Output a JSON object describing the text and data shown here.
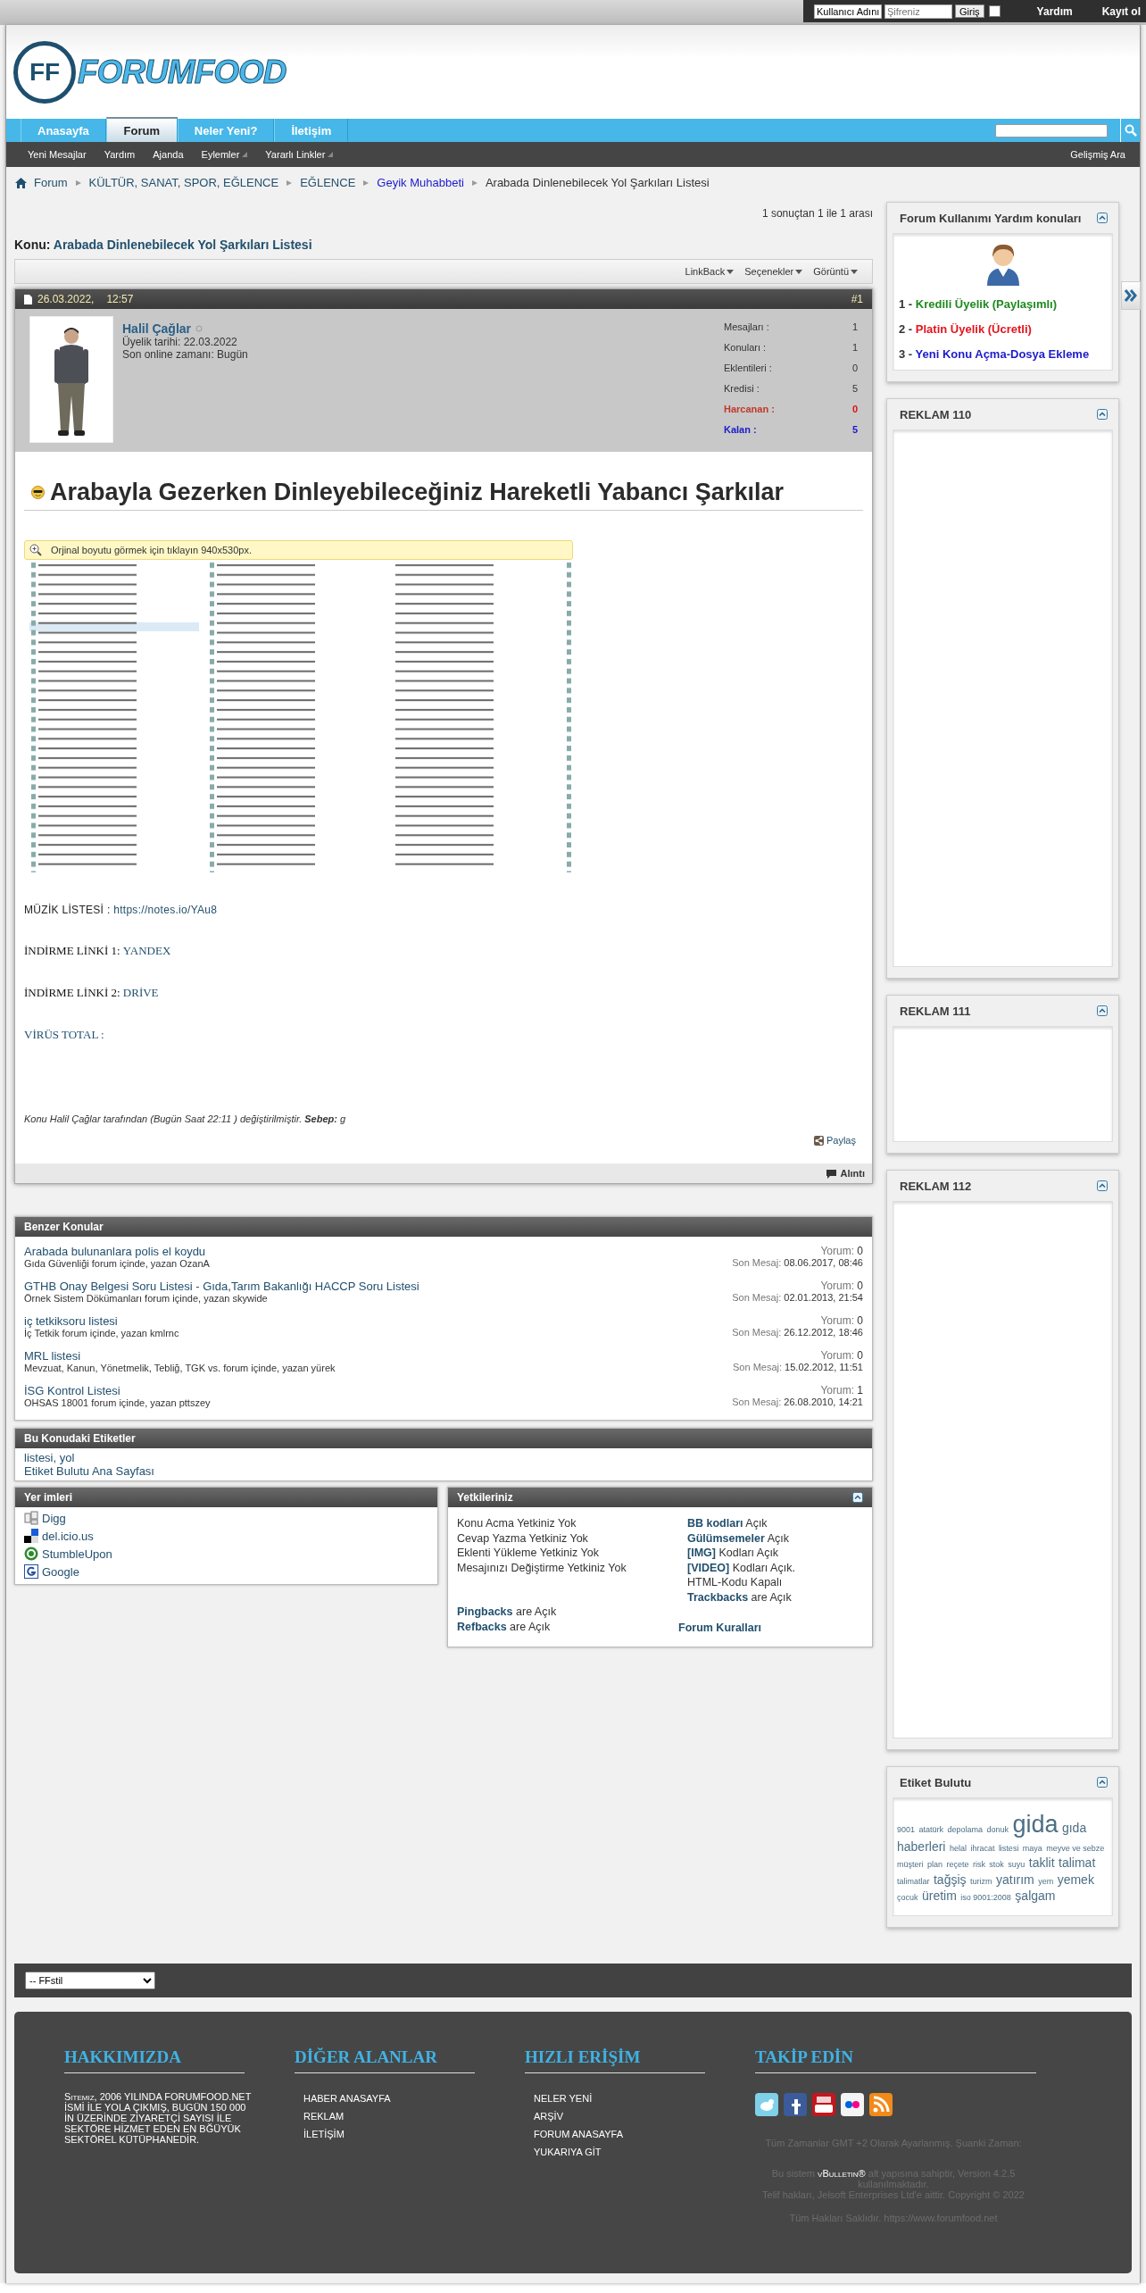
{
  "top_bar": {
    "username_field": {
      "value": "Kullanıcı Adını"
    },
    "password_field": {
      "placeholder": "Şifreniz"
    },
    "login_button": "Giriş",
    "remember_me": {
      "checked": false
    },
    "links": [
      "Yardım",
      "Kayıt ol"
    ]
  },
  "logo": {
    "mark": "FF",
    "name": "FORUMFOOD"
  },
  "nav": {
    "tabs": [
      {
        "label": "Anasayfa",
        "selected": false
      },
      {
        "label": "Forum",
        "selected": true
      },
      {
        "label": "Neler Yeni?",
        "selected": false
      },
      {
        "label": "İletişim",
        "selected": false
      }
    ]
  },
  "sub_nav": {
    "items": [
      {
        "label": "Yeni Mesajlar",
        "has_menu": false
      },
      {
        "label": "Yardım",
        "has_menu": false
      },
      {
        "label": "Ajanda",
        "has_menu": false
      },
      {
        "label": "Eylemler",
        "has_menu": true
      },
      {
        "label": "Yararlı Linkler",
        "has_menu": true
      }
    ],
    "right": "Gelişmiş Ara"
  },
  "breadcrumb": [
    {
      "label": "Forum",
      "kind": "link"
    },
    {
      "label": "KÜLTÜR, SANAT, SPOR, EĞLENCE",
      "kind": "link"
    },
    {
      "label": "EĞLENCE",
      "kind": "link"
    },
    {
      "label": "Geyik Muhabbeti",
      "kind": "forum"
    },
    {
      "label": "Arabada Dinlenebilecek Yol Şarkıları Listesi",
      "kind": "current"
    }
  ],
  "pagination_info": "1 sonuçtan 1 ile 1 arası",
  "thread": {
    "prefix": "Konu:",
    "title": "Arabada Dinlenebilecek Yol Şarkıları Listesi"
  },
  "toolbar": [
    "LinkBack",
    "Seçenekler",
    "Görüntü"
  ],
  "post": {
    "date": "26.03.2022,",
    "time": "12:57",
    "number": "#1",
    "author": {
      "name": "Halil Çağlar",
      "online": false,
      "joined": "Üyelik tarihi: 22.03.2022",
      "last_online": "Son online zamanı: Bugün"
    },
    "stats": [
      {
        "label": "Mesajları :",
        "value": "1",
        "kind": "plain"
      },
      {
        "label": "Konuları :",
        "value": "1",
        "kind": "plain"
      },
      {
        "label": "Eklentileri :",
        "value": "0",
        "kind": "plain"
      },
      {
        "label": "Kredisi :",
        "value": "5",
        "kind": "plain"
      },
      {
        "label": "Harcanan :",
        "value": "0",
        "kind": "spent"
      },
      {
        "label": "Kalan :",
        "value": "5",
        "kind": "remaining"
      }
    ],
    "heading": "Arabayla Gezerken Dinleyebileceğiniz Hareketli Yabancı Şarkılar",
    "image_notice": "Orjinal boyutu görmek için tıklayın 940x530px.",
    "lines": [
      {
        "label": "MÜZİK LİSTESİ : ",
        "link": "https://notes.io/YAu8",
        "kind": "sans"
      },
      {
        "label": "İNDİRME LİNKİ 1: ",
        "link": "YANDEX",
        "kind": "serif"
      },
      {
        "label": "İNDİRME LİNKİ 2: ",
        "link": "DRİVE",
        "kind": "serif"
      },
      {
        "link": "VİRÜS TOTAL :",
        "kind": "serif"
      }
    ],
    "edit_note": "Konu Halil Çağlar tarafından (Bugün Saat 22:11 ) değiştirilmiştir. **Sebep:** g",
    "share": "Paylaş",
    "quote": "Alıntı"
  },
  "similar": {
    "title": "Benzer Konular",
    "items": [
      {
        "title": "Arabada bulunanlara polis el koydu",
        "info": "Gıda Güvenliği forum içinde, yazan OzanA",
        "replies_label": "Yorum:",
        "replies": "0",
        "last_label": "Son Mesaj:",
        "last": "08.06.2017, 08:46"
      },
      {
        "title": "GTHB Onay Belgesi Soru Listesi - Gıda,Tarım Bakanlığı HACCP Soru Listesi",
        "info": "Örnek Sistem Dökümanları forum içinde, yazan skywide",
        "replies_label": "Yorum:",
        "replies": "0",
        "last_label": "Son Mesaj:",
        "last": "02.01.2013, 21:54"
      },
      {
        "title": "iç tetkiksoru listesi",
        "info": "İç Tetkik forum içinde, yazan kmlrnc",
        "replies_label": "Yorum:",
        "replies": "0",
        "last_label": "Son Mesaj:",
        "last": "26.12.2012, 18:46"
      },
      {
        "title": "MRL listesi",
        "info": "Mevzuat, Kanun, Yönetmelik, Tebliğ, TGK vs. forum içinde, yazan yürek",
        "replies_label": "Yorum:",
        "replies": "0",
        "last_label": "Son Mesaj:",
        "last": "15.02.2012, 11:51"
      },
      {
        "title": "İSG Kontrol Listesi",
        "info": "OHSAS 18001 forum içinde, yazan pttszey",
        "replies_label": "Yorum:",
        "replies": "1",
        "last_label": "Son Mesaj:",
        "last": "26.08.2010, 14:21"
      }
    ]
  },
  "thread_tags": {
    "title": "Bu Konudaki Etiketler",
    "tags": "listesi, yol",
    "cloud_link": "Etiket Bulutu Ana Sayfası"
  },
  "bookmarks": {
    "title": "Yer imleri",
    "items": [
      {
        "label": "Digg",
        "kind": "digg"
      },
      {
        "label": "del.icio.us",
        "kind": "delicious"
      },
      {
        "label": "StumbleUpon",
        "kind": "stumbleupon"
      },
      {
        "label": "Google",
        "kind": "google"
      }
    ]
  },
  "permissions": {
    "title": "Yetkileriniz",
    "left": [
      "Konu Acma Yetkiniz Yok",
      "Cevap Yazma Yetkiniz Yok",
      "Eklenti Yükleme Yetkiniz Yok",
      "Mesajınızı Değiştirme Yetkiniz Yok"
    ],
    "right": [
      {
        "key": "BB kodları",
        "text": "Açık"
      },
      {
        "key": "Gülümsemeler",
        "text": "Açık"
      },
      {
        "key": "[IMG]",
        "text": "Kodları Açık"
      },
      {
        "key": "[VIDEO]",
        "text": "Kodları Açık."
      },
      {
        "text": "HTML-Kodu Kapalı"
      },
      {
        "key": "Trackbacks",
        "text": "are Açık"
      }
    ],
    "bottom": [
      {
        "key": "Pingbacks",
        "text": "are Açık"
      },
      {
        "key": "Refbacks",
        "text": "are Açık"
      }
    ],
    "rules_link": "Forum Kuralları"
  },
  "sidebar": [
    {
      "kind": "help",
      "title": "Forum Kullanımı Yardım konuları",
      "items": [
        {
          "number": "1 -",
          "label": "Kredili Üyelik (Paylaşımlı)",
          "color": "#1f8a1f"
        },
        {
          "number": "2 -",
          "label": "Platin Üyelik (Ücretli)",
          "color": "#e3141c"
        },
        {
          "number": "3 -",
          "label": "Yeni Konu Açma-Dosya Ekleme",
          "color": "#1c1ccc"
        }
      ]
    },
    {
      "kind": "ad",
      "title": "REKLAM 110"
    },
    {
      "kind": "ad",
      "title": "REKLAM 111"
    },
    {
      "kind": "ad",
      "title": "REKLAM 112"
    },
    {
      "kind": "tags",
      "title": "Etiket Bulutu",
      "tags": [
        {
          "label": "9001",
          "kind": "small"
        },
        {
          "label": "atatürk",
          "kind": "small"
        },
        {
          "label": "depolama",
          "kind": "small"
        },
        {
          "label": "donuk",
          "kind": "small"
        },
        {
          "label": "gida",
          "kind": "huge"
        },
        {
          "label": "gıda",
          "kind": "medium"
        },
        {
          "label": "haberleri",
          "kind": "medium"
        },
        {
          "label": "helal",
          "kind": "small"
        },
        {
          "label": "ihracat",
          "kind": "small"
        },
        {
          "label": "listesi",
          "kind": "small"
        },
        {
          "label": "maya",
          "kind": "small"
        },
        {
          "label": "meyve ve sebze",
          "kind": "small"
        },
        {
          "label": "müşteri",
          "kind": "small"
        },
        {
          "label": "plan",
          "kind": "small"
        },
        {
          "label": "reçete",
          "kind": "small"
        },
        {
          "label": "risk",
          "kind": "small"
        },
        {
          "label": "stok",
          "kind": "small"
        },
        {
          "label": "suyu",
          "kind": "small"
        },
        {
          "label": "taklit",
          "kind": "medium"
        },
        {
          "label": "talimat",
          "kind": "medium"
        },
        {
          "label": "talimatlar",
          "kind": "small"
        },
        {
          "label": "tağşiş",
          "kind": "medium"
        },
        {
          "label": "turizm",
          "kind": "small"
        },
        {
          "label": "yatırım",
          "kind": "medium"
        },
        {
          "label": "yem",
          "kind": "small"
        },
        {
          "label": "yemek",
          "kind": "medium"
        },
        {
          "label": "çocuk",
          "kind": "small"
        },
        {
          "label": "üretim",
          "kind": "medium"
        },
        {
          "label": "iso 9001:2008",
          "kind": "small"
        },
        {
          "label": "şalgam",
          "kind": "medium"
        }
      ]
    }
  ],
  "style_chooser": {
    "value": "-- FFstil"
  },
  "footer": {
    "columns": [
      {
        "kind": "text",
        "title": "HAKKIMIZDA",
        "lead": "Sitemiz,",
        "text": "2006 YILINDA FORUMFOOD.NET İSMİ İLE YOLA ÇIKMIŞ, BUGÜN 150 000 İN ÜZERİNDE ZİYARETÇİ SAYISI İLE SEKTÖRE HİZMET EDEN EN BĞÜYÜK SEKTÖREL KÜTÜPHANEDİR."
      },
      {
        "kind": "links",
        "title": "DİĞER ALANLAR",
        "links": [
          "HABER ANASAYFA",
          "REKLAM",
          "İLETİŞİM"
        ]
      },
      {
        "kind": "links",
        "title": "HIZLI ERİŞİM",
        "links": [
          "NELER YENİ",
          "ARŞİV",
          "FORUM ANASAYFA",
          "YUKARIYA GİT"
        ]
      },
      {
        "kind": "social",
        "title": "TAKİP EDİN",
        "icons": [
          {
            "kind": "twitter"
          },
          {
            "kind": "facebook"
          },
          {
            "kind": "youtube"
          },
          {
            "kind": "flickr"
          },
          {
            "kind": "rss"
          }
        ],
        "notes": [
          "Tüm Zamanlar GMT +2 Olarak Ayarlanmış. Şuanki Zaman:"
        ],
        "engine": {
          "before": "Bu sistem",
          "brand": "vBulletin®",
          "after": "alt yapısına sahiptir, Version 4.2.5 kullanılmaktadır."
        },
        "copyright": "Telif hakları, Jelsoft Enterprises Ltd'e aittir. Copyright © 2022",
        "rights": "Tüm Hakları Saklıdır. https://www.forumfood.net"
      }
    ]
  }
}
